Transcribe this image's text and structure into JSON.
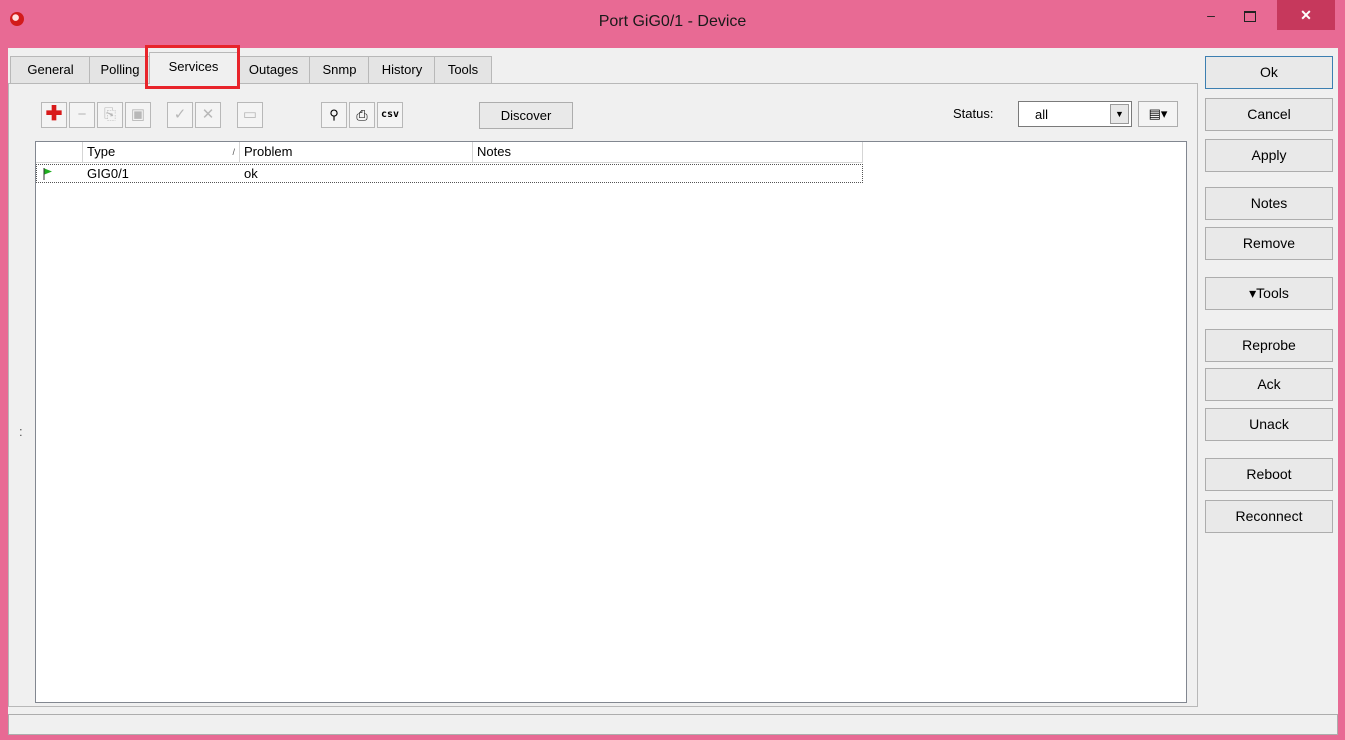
{
  "window": {
    "title": "Port GiG0/1 - Device",
    "minimize": "–",
    "close": "✕"
  },
  "tabs": [
    {
      "label": "General"
    },
    {
      "label": "Polling"
    },
    {
      "label": "Services",
      "active": true
    },
    {
      "label": "Outages"
    },
    {
      "label": "Snmp"
    },
    {
      "label": "History"
    },
    {
      "label": "Tools"
    }
  ],
  "toolbar": {
    "discover_label": "Discover",
    "status_label": "Status:",
    "status_value": "all",
    "icons": [
      "add-icon",
      "remove-icon",
      "copy-icon",
      "paste-icon",
      "enable-icon",
      "disable-icon",
      "comment-icon",
      "find-icon",
      "print-icon",
      "csv-icon"
    ],
    "csv_text": "csv"
  },
  "table": {
    "columns": [
      "Type",
      "Problem",
      "Notes"
    ],
    "sort_indicator": "/",
    "rows": [
      {
        "type": "GIG0/1",
        "problem": "ok",
        "notes": ""
      }
    ]
  },
  "side_buttons": {
    "ok": "Ok",
    "cancel": "Cancel",
    "apply": "Apply",
    "notes": "Notes",
    "remove": "Remove",
    "tools": "▾Tools",
    "reprobe": "Reprobe",
    "ack": "Ack",
    "unack": "Unack",
    "reboot": "Reboot",
    "reconnect": "Reconnect"
  },
  "colors": {
    "titlebar": "#e86a94",
    "close_button": "#c6385c",
    "highlight": "#e8242b",
    "flag_green": "#1fae1f"
  }
}
